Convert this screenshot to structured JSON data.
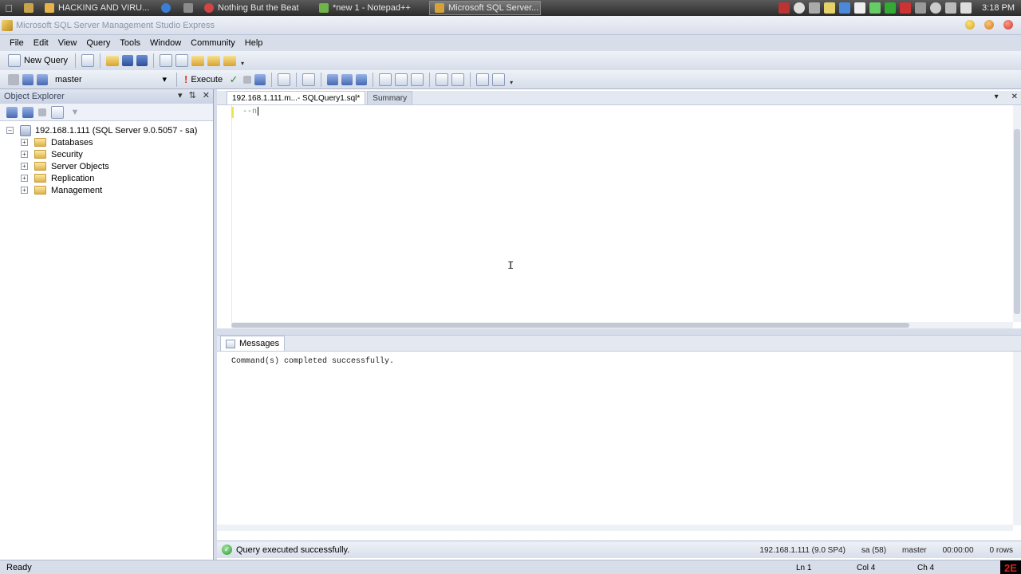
{
  "taskbar": {
    "items": [
      {
        "label": "HACKING AND VIRU...",
        "color": "#e8b24a"
      },
      {
        "label": "",
        "color": "#3a7fd5"
      },
      {
        "label": "",
        "color": "#8b8b8b"
      },
      {
        "label": "Nothing But the Beat",
        "color": "#d04545"
      },
      {
        "label": "*new 1 - Notepad++",
        "color": "#6fb34a"
      },
      {
        "label": "Microsoft SQL Server...",
        "color": "#d4a238"
      }
    ],
    "clock": "3:18 PM"
  },
  "window": {
    "title": "Microsoft SQL Server Management Studio Express"
  },
  "menu": [
    "File",
    "Edit",
    "View",
    "Query",
    "Tools",
    "Window",
    "Community",
    "Help"
  ],
  "toolbar": {
    "new_query": "New Query",
    "database": "master",
    "execute": "Execute"
  },
  "object_explorer": {
    "title": "Object Explorer",
    "server": "192.168.1.111 (SQL Server 9.0.5057 - sa)",
    "nodes": [
      "Databases",
      "Security",
      "Server Objects",
      "Replication",
      "Management"
    ]
  },
  "editor": {
    "tabs": [
      "192.168.1.111.m...- SQLQuery1.sql*",
      "Summary"
    ],
    "code": "--n"
  },
  "results": {
    "tab": "Messages",
    "message": "Command(s) completed successfully."
  },
  "query_status": {
    "text": "Query executed successfully.",
    "server": "192.168.1.111 (9.0 SP4)",
    "user": "sa (58)",
    "database": "master",
    "time": "00:00:00",
    "rows": "0 rows"
  },
  "statusbar": {
    "ready": "Ready",
    "ln": "Ln 1",
    "col": "Col 4",
    "ch": "Ch 4",
    "corner": "2E"
  }
}
